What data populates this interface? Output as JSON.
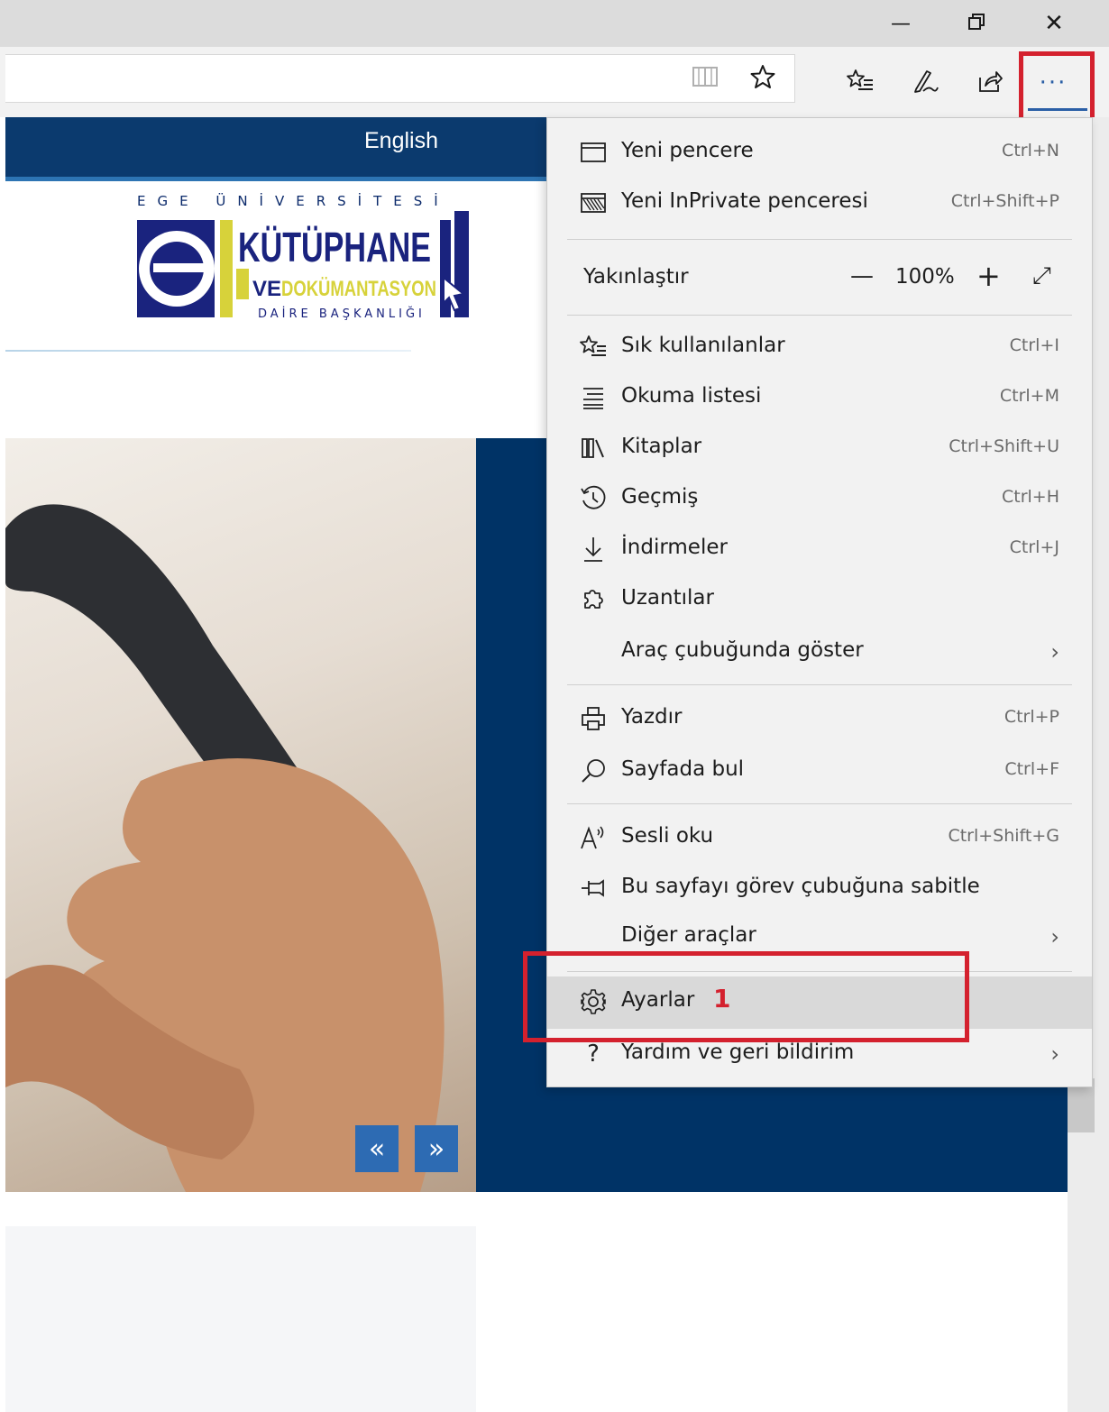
{
  "titlebar": {
    "minimize": "—",
    "restore": "❐",
    "close": "✕"
  },
  "toolbar": {
    "reading_view_icon": "book-icon",
    "favorite_icon": "star-icon",
    "favorites_hub_icon": "favorites-list-icon",
    "notes_icon": "pen-icon",
    "share_icon": "share-icon",
    "more_label": "···"
  },
  "page": {
    "language_link": "English",
    "logo": {
      "top_line": "EGE ÜNİVERSİTESİ",
      "title": "KÜTÜPHANE",
      "subtitle_ve": "VE",
      "subtitle": "DOKÜMANTASYON",
      "bottom_line": "DAİRE BAŞKANLIĞI"
    },
    "slider_prev": "«",
    "slider_next": "»"
  },
  "menu": {
    "items": [
      {
        "icon": "window-icon",
        "label": "Yeni pencere",
        "shortcut": "Ctrl+N"
      },
      {
        "icon": "inprivate-icon",
        "label": "Yeni InPrivate penceresi",
        "shortcut": "Ctrl+Shift+P"
      },
      {
        "label": "Yakınlaştır",
        "zoom_minus": "—",
        "zoom_value": "100%",
        "zoom_plus": "+",
        "fullscreen": "⤢"
      },
      {
        "icon": "favorites-icon",
        "label": "Sık kullanılanlar",
        "shortcut": "Ctrl+I"
      },
      {
        "icon": "reading-list-icon",
        "label": "Okuma listesi",
        "shortcut": "Ctrl+M"
      },
      {
        "icon": "books-icon",
        "label": "Kitaplar",
        "shortcut": "Ctrl+Shift+U"
      },
      {
        "icon": "history-icon",
        "label": "Geçmiş",
        "shortcut": "Ctrl+H"
      },
      {
        "icon": "download-icon",
        "label": "İndirmeler",
        "shortcut": "Ctrl+J"
      },
      {
        "icon": "extensions-icon",
        "label": "Uzantılar",
        "shortcut": ""
      },
      {
        "label": "Araç çubuğunda göster",
        "chevron": "›"
      },
      {
        "icon": "print-icon",
        "label": "Yazdır",
        "shortcut": "Ctrl+P"
      },
      {
        "icon": "find-icon",
        "label": "Sayfada bul",
        "shortcut": "Ctrl+F"
      },
      {
        "icon": "read-aloud-icon",
        "label": "Sesli oku",
        "shortcut": "Ctrl+Shift+G"
      },
      {
        "icon": "pin-icon",
        "label": "Bu sayfayı görev çubuğuna sabitle",
        "shortcut": ""
      },
      {
        "label": "Diğer araçlar",
        "chevron": "›"
      },
      {
        "icon": "gear-icon",
        "label": "Ayarlar",
        "annotation": "1"
      },
      {
        "icon": "help-icon",
        "label": "Yardım ve geri bildirim",
        "chevron": "›"
      }
    ]
  },
  "colors": {
    "header_blue": "#0b3a6e",
    "panel_blue": "#003366",
    "highlight_red": "#d4212e",
    "menu_bg": "#f2f2f2"
  }
}
